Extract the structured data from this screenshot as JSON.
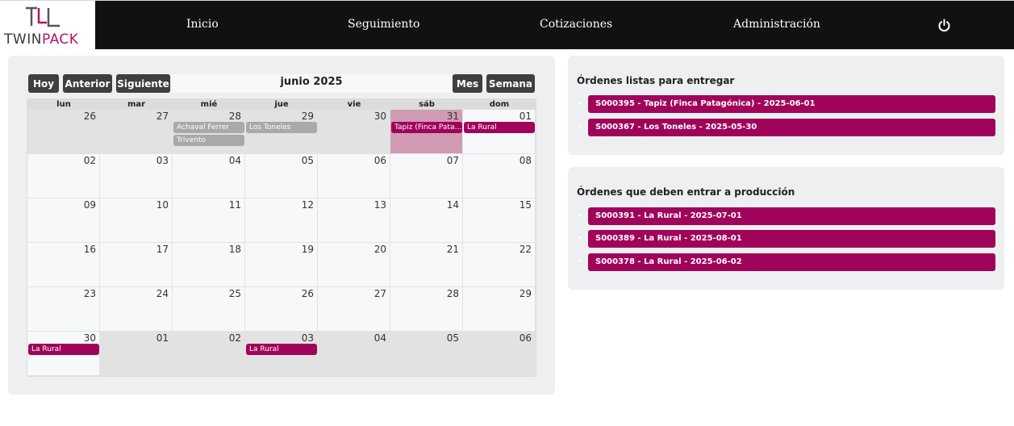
{
  "brand": {
    "text_a": "TWIN",
    "text_b": "PACK",
    "accent": "#b3126d"
  },
  "nav": {
    "items": [
      "Inicio",
      "Seguimiento",
      "Cotizaciones",
      "Administración"
    ],
    "power_icon": "power-icon"
  },
  "calendar": {
    "buttons": {
      "today": "Hoy",
      "prev": "Anterior",
      "next": "Siguiente",
      "month": "Mes",
      "week": "Semana"
    },
    "title": "junio 2025",
    "weekdays": [
      "lun",
      "mar",
      "mié",
      "jue",
      "vie",
      "sáb",
      "dom"
    ],
    "weeks": [
      [
        "26",
        "27",
        "28",
        "29",
        "30",
        "31",
        "01"
      ],
      [
        "02",
        "03",
        "04",
        "05",
        "06",
        "07",
        "08"
      ],
      [
        "09",
        "10",
        "11",
        "12",
        "13",
        "14",
        "15"
      ],
      [
        "16",
        "17",
        "18",
        "19",
        "20",
        "21",
        "22"
      ],
      [
        "23",
        "24",
        "25",
        "26",
        "27",
        "28",
        "29"
      ],
      [
        "30",
        "01",
        "02",
        "03",
        "04",
        "05",
        "06"
      ]
    ],
    "events": [
      {
        "label": "Achaval Ferrer",
        "week": 0,
        "day": 2,
        "slot": 0,
        "color": "gray"
      },
      {
        "label": "Trivento",
        "week": 0,
        "day": 2,
        "slot": 1,
        "color": "gray"
      },
      {
        "label": "Los Toneles",
        "week": 0,
        "day": 3,
        "slot": 0,
        "color": "gray"
      },
      {
        "label": "Tapiz (Finca Patagónica)",
        "week": 0,
        "day": 5,
        "slot": 0,
        "color": "mag"
      },
      {
        "label": "La Rural",
        "week": 0,
        "day": 6,
        "slot": 0,
        "color": "mag"
      },
      {
        "label": "La Rural",
        "week": 5,
        "day": 0,
        "slot": 0,
        "color": "mag"
      },
      {
        "label": "La Rural",
        "week": 5,
        "day": 3,
        "slot": 0,
        "color": "mag"
      }
    ],
    "colors": {
      "magenta": "#a0045a",
      "gray": "#a9a9a9",
      "today_bg": "#d19bb5",
      "other_month_bg": "#e2e2e2"
    }
  },
  "ready": {
    "title": "Órdenes listas para entregar",
    "items": [
      "S000395 - Tapiz (Finca Patagónica) - 2025-06-01",
      "S000367 - Los Toneles - 2025-05-30"
    ]
  },
  "production": {
    "title": "Órdenes que deben entrar a producción",
    "items": [
      "S000391 - La Rural - 2025-07-01",
      "S000389 - La Rural - 2025-08-01",
      "S000378 - La Rural - 2025-06-02"
    ]
  }
}
